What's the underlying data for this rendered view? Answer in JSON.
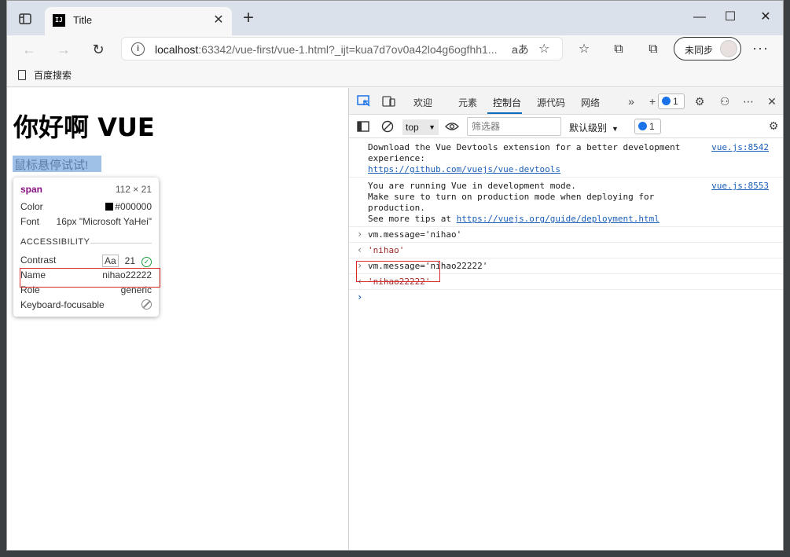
{
  "browser": {
    "tab_title": "Title",
    "tab_favicon": "IJ",
    "url_host": "localhost",
    "url_rest": ":63342/vue-first/vue-1.html?_ijt=kua7d7ov0a42lo4g6ogfhh1...",
    "reader_label": "aあ",
    "profile_label": "未同步",
    "bookmark": "百度搜索"
  },
  "page": {
    "heading": "你好啊 VUE",
    "hover_text": "鼠标悬停试试!"
  },
  "tooltip": {
    "tag": "span",
    "size": "112 × 21",
    "color_label": "Color",
    "color_value": "#000000",
    "font_label": "Font",
    "font_value": "16px \"Microsoft YaHei\"",
    "section": "ACCESSIBILITY",
    "contrast_label": "Contrast",
    "contrast_aa": "Aa",
    "contrast_value": "21",
    "name_label": "Name",
    "name_value": "nihao22222",
    "role_label": "Role",
    "role_value": "generic",
    "keyboard_label": "Keyboard-focusable"
  },
  "devtools": {
    "tabs": [
      "欢迎",
      "元素",
      "控制台",
      "源代码",
      "网络"
    ],
    "issues_count": "1",
    "context": "top",
    "filter_placeholder": "筛选器",
    "levels": "默认级别",
    "filter_issues_count": "1",
    "console": {
      "msg1_text": "Download the Vue Devtools extension for a better development\nexperience:\n",
      "msg1_link": "https://github.com/vuejs/vue-devtools",
      "msg1_src": "vue.js:8542",
      "msg2_text": "You are running Vue in development mode.\nMake sure to turn on production mode when deploying for production.\nSee more tips at ",
      "msg2_link": "https://vuejs.org/guide/deployment.html",
      "msg2_src": "vue.js:8553",
      "cmd1": "vm.message='nihao'",
      "res1": "'nihao'",
      "cmd2": "vm.message='nihao22222'",
      "res2": "'nihao22222'"
    }
  },
  "colors": {
    "accent": "#0f6cbd",
    "highlight_box": "#d92b2b",
    "tag_color": "#881280"
  }
}
